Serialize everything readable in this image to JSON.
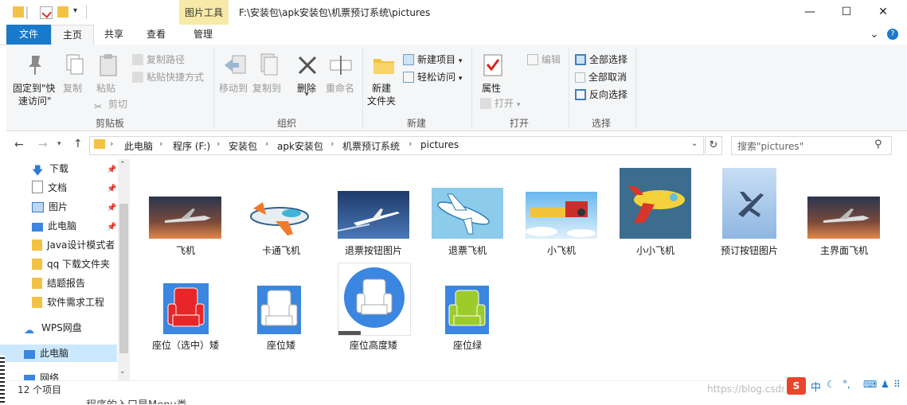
{
  "titlebar": {
    "context_tab": "图片工具",
    "path": "F:\\安装包\\apk安装包\\机票预订系统\\pictures",
    "minimize": "—",
    "maximize": "☐",
    "close": "✕"
  },
  "tabs": {
    "file": "文件",
    "home": "主页",
    "share": "共享",
    "view": "查看",
    "manage": "管理",
    "expand": "⌄",
    "help": "?"
  },
  "ribbon": {
    "clipboard": {
      "group_label": "剪贴板",
      "pin_quick_line1": "固定到\"快",
      "pin_quick_line2": "速访问\"",
      "copy": "复制",
      "paste": "粘贴",
      "copy_path": "复制路径",
      "paste_shortcut": "粘贴快捷方式",
      "cut": "剪切"
    },
    "organize": {
      "group_label": "组织",
      "move_to": "移动到",
      "copy_to": "复制到",
      "delete": "删除",
      "rename": "重命名"
    },
    "new": {
      "group_label": "新建",
      "new_folder_line1": "新建",
      "new_folder_line2": "文件夹",
      "new_item": "新建项目",
      "easy_access": "轻松访问"
    },
    "open": {
      "group_label": "打开",
      "properties": "属性",
      "open": "打开",
      "edit": "编辑"
    },
    "select": {
      "group_label": "选择",
      "select_all": "全部选择",
      "select_none": "全部取消",
      "invert": "反向选择"
    }
  },
  "address": {
    "crumbs": [
      "此电脑",
      "程序 (F:)",
      "安装包",
      "apk安装包",
      "机票预订系统",
      "pictures"
    ],
    "search_placeholder": "搜索\"pictures\""
  },
  "nav": {
    "items": [
      {
        "label": "下载",
        "pinned": true
      },
      {
        "label": "文档",
        "pinned": true
      },
      {
        "label": "图片",
        "pinned": true
      },
      {
        "label": "此电脑",
        "pinned": true
      },
      {
        "label": "Java设计模式者",
        "pinned": false
      },
      {
        "label": "qq 下载文件夹",
        "pinned": false
      },
      {
        "label": "结题报告",
        "pinned": false
      },
      {
        "label": "软件需求工程",
        "pinned": false
      }
    ],
    "wps": "WPS网盘",
    "this_pc": "此电脑",
    "network": "网络"
  },
  "files": [
    {
      "name": "飞机"
    },
    {
      "name": "卡通飞机"
    },
    {
      "name": "退票按钮图片"
    },
    {
      "name": "退票飞机"
    },
    {
      "name": "小飞机"
    },
    {
      "name": "小小飞机"
    },
    {
      "name": "预订按钮图片"
    },
    {
      "name": "主界面飞机"
    },
    {
      "name": "座位（选中）矮"
    },
    {
      "name": "座位矮"
    },
    {
      "name": "座位高度矮"
    },
    {
      "name": "座位绿"
    }
  ],
  "status": {
    "count": "12 个项目",
    "watermark": "https://blog.csdn.net/...",
    "ime": "中",
    "behind_text": "程序的入口是Menu类"
  },
  "colors": {
    "accent": "#1979ca",
    "context_tab": "#f7e9a8",
    "selected": "#cce8ff",
    "seat_blue": "#3a86e0",
    "seat_red": "#e8262a",
    "seat_green": "#9ccc2a"
  }
}
